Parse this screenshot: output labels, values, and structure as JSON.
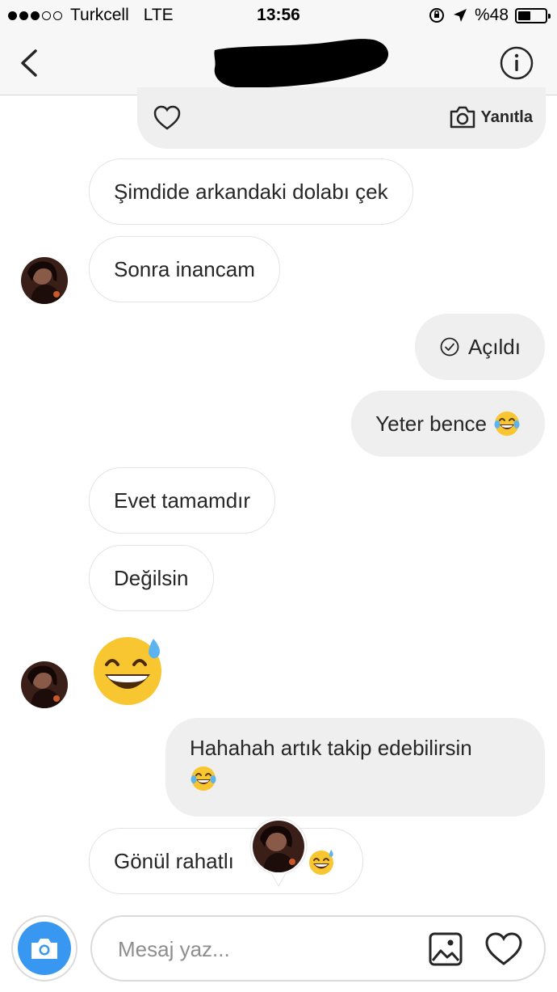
{
  "status_bar": {
    "carrier": "Turkcell",
    "network": "LTE",
    "time": "13:56",
    "battery": "%48",
    "battery_level": 0.48,
    "signal_bars": 3,
    "signal_total": 5
  },
  "header": {
    "back_icon": "chevron-left-icon",
    "info_icon": "info-icon",
    "title_redacted": true
  },
  "story_reply": {
    "like_icon": "heart-outline-icon",
    "reply_label": "Yanıtla",
    "reply_icon": "camera-icon"
  },
  "messages": [
    {
      "sender": "them",
      "text": "Şimdide arkandaki dolabı çek"
    },
    {
      "sender": "them",
      "text": "Sonra inancam"
    },
    {
      "sender": "me",
      "text": "Açıldı",
      "icon": "check-circle-icon"
    },
    {
      "sender": "me",
      "text": "Yeter bence",
      "emoji": "tears-of-joy"
    },
    {
      "sender": "them",
      "text": "Evet tamamdır"
    },
    {
      "sender": "them",
      "text": "Değilsin"
    },
    {
      "sender": "them",
      "emoji": "grinning-sweat"
    },
    {
      "sender": "me",
      "text": "Hahahah artık takip edebilirsin",
      "emoji": "tears-of-joy"
    },
    {
      "sender": "them",
      "text": "Gönül rahatlı",
      "emoji": "grinning-sweat"
    }
  ],
  "composer": {
    "placeholder": "Mesaj yaz...",
    "camera_icon": "camera-icon",
    "gallery_icon": "image-icon",
    "like_icon": "heart-outline-icon"
  },
  "colors": {
    "accent": "#3897f0",
    "incoming_border": "#e3e3e3",
    "outgoing_bg": "#efefef",
    "emoji_yellow": "#f7c631"
  }
}
